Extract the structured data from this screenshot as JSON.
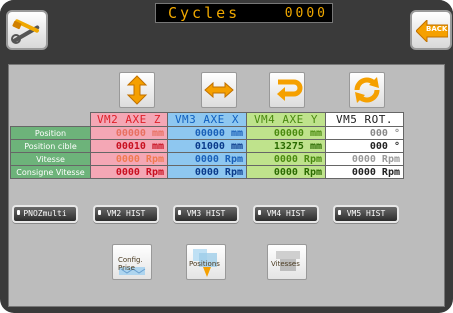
{
  "header": {
    "title": "Cycles",
    "cycle_count": "0000",
    "back_label": "BACK"
  },
  "table": {
    "columns": [
      "VM2 AXE Z",
      "VM3 AXE X",
      "VM4 AXE Y",
      "VM5 ROT."
    ],
    "rows": [
      {
        "label": "Position",
        "values": [
          "00000 mm",
          "00000 mm",
          "00000 mm",
          "000 °"
        ]
      },
      {
        "label": "Position cible",
        "values": [
          "00010 mm",
          "01000 mm",
          "13275 mm",
          "000 °"
        ]
      },
      {
        "label": "Vitesse",
        "values": [
          "0000 Rpm",
          "0000 Rpm",
          "0000 Rpm",
          "0000 Rpm"
        ]
      },
      {
        "label": "Consigne Vitesse",
        "values": [
          "0000 Rpm",
          "0000 Rpm",
          "0000 Rpm",
          "0000 Rpm"
        ]
      }
    ]
  },
  "hist_buttons": [
    "PNOZmulti",
    "VM2 HIST",
    "VM3 HIST",
    "VM4 HIST",
    "VM5 HIST"
  ],
  "nav_buttons": {
    "config": "Config. Prise",
    "positions": "Positions",
    "vitesses": "Vitesses"
  },
  "colors": {
    "title_amber": "#f0a800",
    "vm2": "#f4a7b5",
    "vm3": "#8ec7f0",
    "vm4": "#bfe38c",
    "vm5": "#ffffff",
    "label_green": "#6db37a",
    "arrow_orange": "#f5a000"
  },
  "icons": [
    "wrench-screwdriver-icon",
    "back-arrow-icon",
    "vertical-arrow-icon",
    "horizontal-arrow-icon",
    "return-arrow-icon",
    "rotation-icon"
  ]
}
